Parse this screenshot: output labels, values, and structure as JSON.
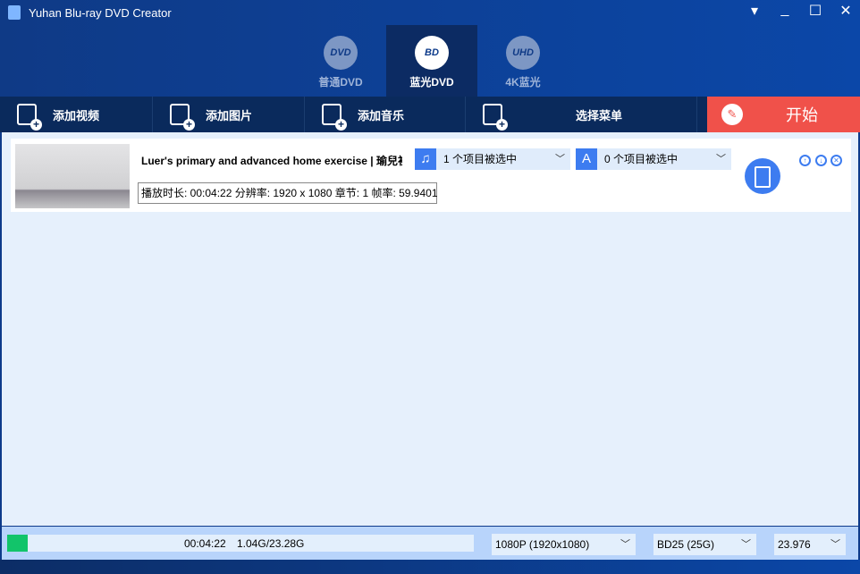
{
  "window": {
    "title": "Yuhan Blu-ray DVD Creator",
    "controls": [
      "▾",
      "_",
      "☐",
      "✕"
    ]
  },
  "modes": [
    {
      "label": "普通DVD",
      "icon": "DVD",
      "active": false
    },
    {
      "label": "蓝光DVD",
      "icon": "BD",
      "active": true
    },
    {
      "label": "4K蓝光",
      "icon": "UHD",
      "active": false
    }
  ],
  "toolbar": {
    "add_video": "添加视频",
    "add_image": "添加图片",
    "add_music": "添加音乐",
    "select_menu": "选择菜单",
    "start": "开始"
  },
  "item": {
    "name": "Luer's primary and advanced home exercise | 瑜兒初",
    "info": "播放时长: 00:04:22  分辨率: 1920 x 1080  章节: 1  帧率: 59.9401",
    "audio": "1 个项目被选中",
    "subtitle": "0 个项目被选中",
    "subtitle_icon": "A"
  },
  "bottom": {
    "progress_percent": 4.5,
    "duration": "00:04:22",
    "size": "1.04G/23.28G",
    "resolution": "1080P (1920x1080)",
    "disc": "BD25 (25G)",
    "fps": "23.976"
  },
  "colors": {
    "accent": "#3d7cf0",
    "start": "#f0514a",
    "progress": "#12c46a"
  }
}
